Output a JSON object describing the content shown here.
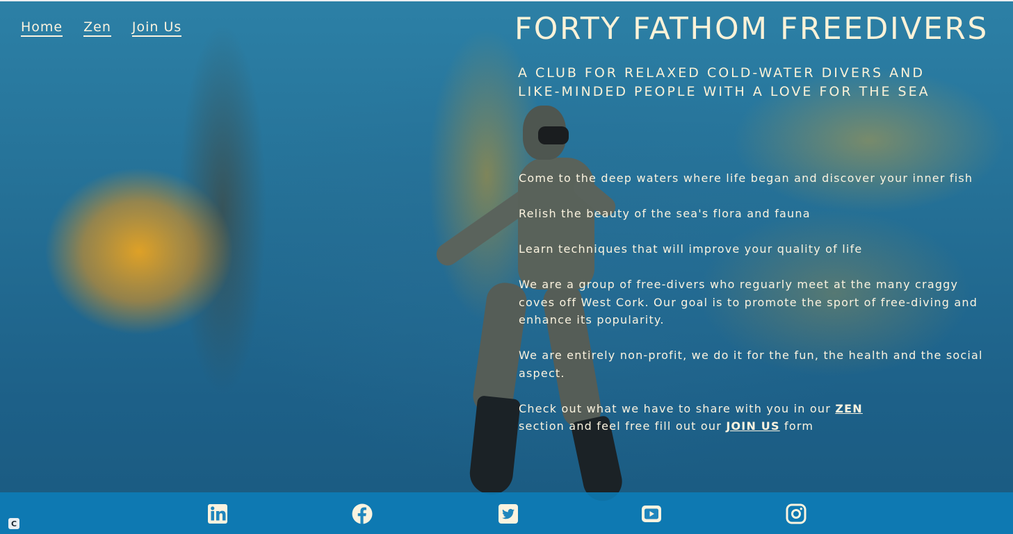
{
  "nav": {
    "home": "Home",
    "zen": "Zen",
    "join": "Join Us"
  },
  "header": {
    "title": "FORTY FATHOM FREEDIVERS",
    "tagline_line1": "A CLUB FOR RELAXED COLD-WATER DIVERS AND",
    "tagline_line2": "LIKE-MINDED PEOPLE WITH A LOVE FOR THE SEA"
  },
  "main": {
    "p1": "Come to the deep waters where life began and discover your inner fish",
    "p2": "Relish the beauty of the sea's flora and fauna",
    "p3": "Learn techniques that will improve your quality of life",
    "p4": "We are a group of free-divers who reguarly meet at the many craggy coves off West Cork. Our goal is to promote the sport of free-diving and enhance its popularity.",
    "p5": "We are entirely non-profit, we do it for the fun, the health and the social aspect.",
    "p6_before": "Check out what we have to share with you in our",
    "p6_zen_link": "ZEN",
    "p6_middle": "section and feel free fill out our",
    "p6_join_link": "JOIN US",
    "p6_after": "form"
  },
  "footer": {
    "social_icons": [
      "linkedin-icon",
      "facebook-icon",
      "twitter-icon",
      "youtube-icon",
      "instagram-icon"
    ],
    "badge": "C"
  },
  "colors": {
    "text_cream": "#fbf3df",
    "footer_bar": "#0c7db8",
    "water_blue": "#246f95"
  }
}
